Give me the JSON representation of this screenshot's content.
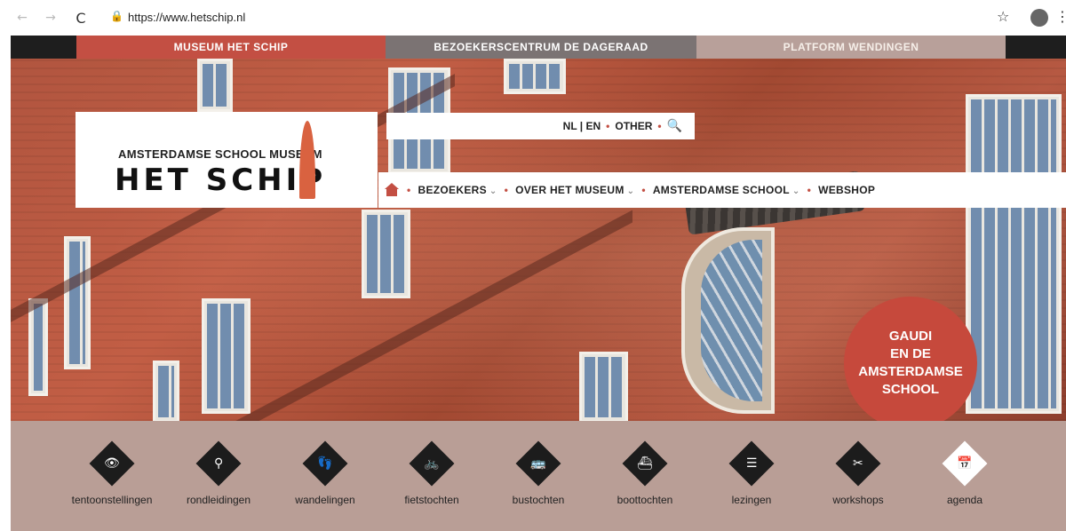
{
  "browser": {
    "url": "https://www.hetschip.nl",
    "back_icon": "←",
    "forward_icon": "→",
    "reload_icon": "C",
    "lock_icon": "🔒",
    "star_icon": "☆",
    "menu_icon": "⋮"
  },
  "topbar": {
    "tabs": [
      {
        "label": "MUSEUM HET SCHIP",
        "color": "#c34f43"
      },
      {
        "label": "BEZOEKERSCENTRUM DE DAGERAAD",
        "color": "#7b7373"
      },
      {
        "label": "PLATFORM WENDINGEN",
        "color": "#b8a09a"
      }
    ]
  },
  "logo": {
    "tagline": "AMSTERDAMSE SCHOOL MUSEUM",
    "name": "HET SCHIP"
  },
  "lang_bar": {
    "lang": "NL | EN",
    "other": "OTHER",
    "search_icon": "🔍"
  },
  "main_nav": {
    "items": [
      {
        "label": "BEZOEKERS",
        "chevron": "⌄"
      },
      {
        "label": "OVER HET MUSEUM",
        "chevron": "⌄"
      },
      {
        "label": "AMSTERDAMSE SCHOOL",
        "chevron": "⌄"
      },
      {
        "label": "WEBSHOP"
      }
    ],
    "separator": "•"
  },
  "promo": {
    "line1": "GAUDI",
    "line2": "EN DE",
    "line3": "AMSTERDAMSE",
    "line4": "SCHOOL",
    "color": "#c6493c"
  },
  "categories": [
    {
      "label": "tentoonstellingen",
      "icon": "eye-icon",
      "glyph": "👁"
    },
    {
      "label": "rondleidingen",
      "icon": "guide-icon",
      "glyph": "⚲"
    },
    {
      "label": "wandelingen",
      "icon": "footsteps-icon",
      "glyph": "👣"
    },
    {
      "label": "fietstochten",
      "icon": "bicycle-icon",
      "glyph": "🚲"
    },
    {
      "label": "bustochten",
      "icon": "bus-icon",
      "glyph": "🚌"
    },
    {
      "label": "boottochten",
      "icon": "boat-icon",
      "glyph": "⛴"
    },
    {
      "label": "lezingen",
      "icon": "document-icon",
      "glyph": "☰"
    },
    {
      "label": "workshops",
      "icon": "tools-icon",
      "glyph": "✂"
    },
    {
      "label": "agenda",
      "icon": "calendar-icon",
      "glyph": "📅"
    }
  ]
}
